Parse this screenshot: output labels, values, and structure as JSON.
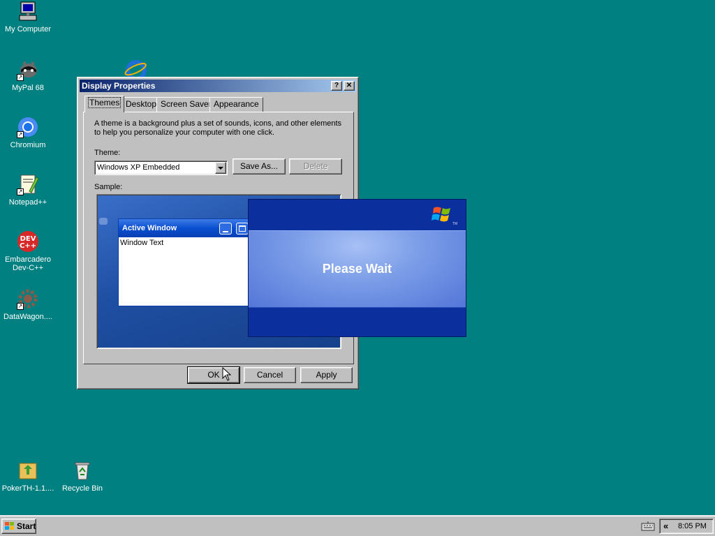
{
  "desktop": {
    "icons": [
      {
        "label": "My Computer"
      },
      {
        "label": "MyPal 68"
      },
      {
        "label": "Chromium"
      },
      {
        "label": "Notepad++"
      },
      {
        "label": "Embarcadero Dev-C++"
      },
      {
        "label": "DataWagon...."
      },
      {
        "label": "PokerTH-1.1...."
      },
      {
        "label": "Recycle Bin"
      }
    ]
  },
  "dialog": {
    "title": "Display Properties",
    "help_glyph": "?",
    "close_glyph": "✕",
    "tabs": [
      {
        "label": "Themes",
        "active": true
      },
      {
        "label": "Desktop"
      },
      {
        "label": "Screen Saver"
      },
      {
        "label": "Appearance"
      }
    ],
    "description": "A theme is a background plus a set of sounds, icons, and other elements to help you personalize your computer with one click.",
    "theme_label": "Theme:",
    "theme_value": "Windows XP Embedded",
    "save_as_label": "Save As...",
    "delete_label": "Delete",
    "sample_label": "Sample:",
    "sample": {
      "active_window_title": "Active Window",
      "window_text": "Window Text"
    },
    "buttons": {
      "ok": "OK",
      "cancel": "Cancel",
      "apply": "Apply"
    }
  },
  "splash": {
    "message": "Please Wait",
    "tm": "TM"
  },
  "taskbar": {
    "start_label": "Start",
    "tray_chevron": "«",
    "clock": "8:05 PM"
  },
  "colors": {
    "desktop": "#008080",
    "title_active": "#0a246a",
    "xp_blue": "#003399"
  }
}
